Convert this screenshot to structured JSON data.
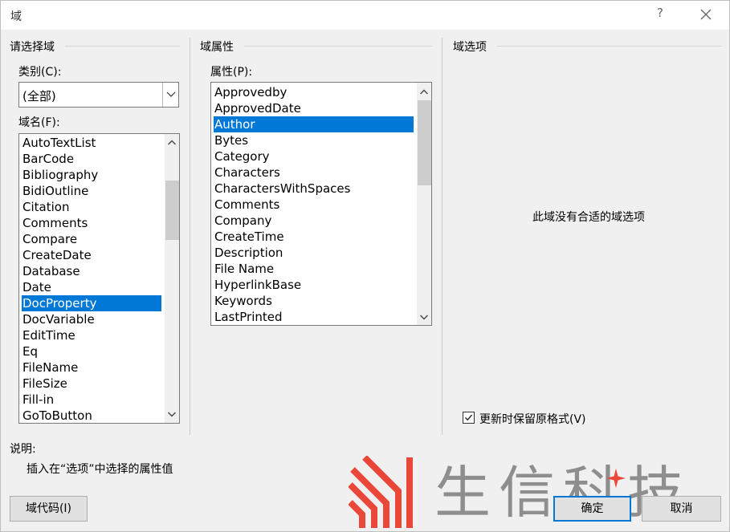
{
  "window": {
    "title": "域",
    "help": "?"
  },
  "left": {
    "group_title": "请选择域",
    "category_label": "类别(C):",
    "category_value": "(全部)",
    "fieldname_label": "域名(F):",
    "fields": [
      "AutoTextList",
      "BarCode",
      "Bibliography",
      "BidiOutline",
      "Citation",
      "Comments",
      "Compare",
      "CreateDate",
      "Database",
      "Date",
      "DocProperty",
      "DocVariable",
      "EditTime",
      "Eq",
      "FileName",
      "FileSize",
      "Fill-in",
      "GoToButton"
    ],
    "selected_field": "DocProperty"
  },
  "middle": {
    "group_title": "域属性",
    "property_label": "属性(P):",
    "properties": [
      "Approvedby",
      "ApprovedDate",
      "Author",
      "Bytes",
      "Category",
      "Characters",
      "CharactersWithSpaces",
      "Comments",
      "Company",
      "CreateTime",
      "Description",
      "File Name",
      "HyperlinkBase",
      "Keywords",
      "LastPrinted"
    ],
    "selected_property": "Author"
  },
  "right": {
    "group_title": "域选项",
    "no_options": "此域没有合适的域选项",
    "preserve_format_label": "更新时保留原格式(V)",
    "preserve_format_checked": true
  },
  "description": {
    "label": "说明:",
    "text": "插入在“选项”中选择的属性值"
  },
  "buttons": {
    "field_codes": "域代码(I)",
    "ok": "确定",
    "cancel": "取消"
  },
  "watermark": {
    "text": "生信科技",
    "logo_color": "#e8473a",
    "star_color": "#e8473a"
  }
}
